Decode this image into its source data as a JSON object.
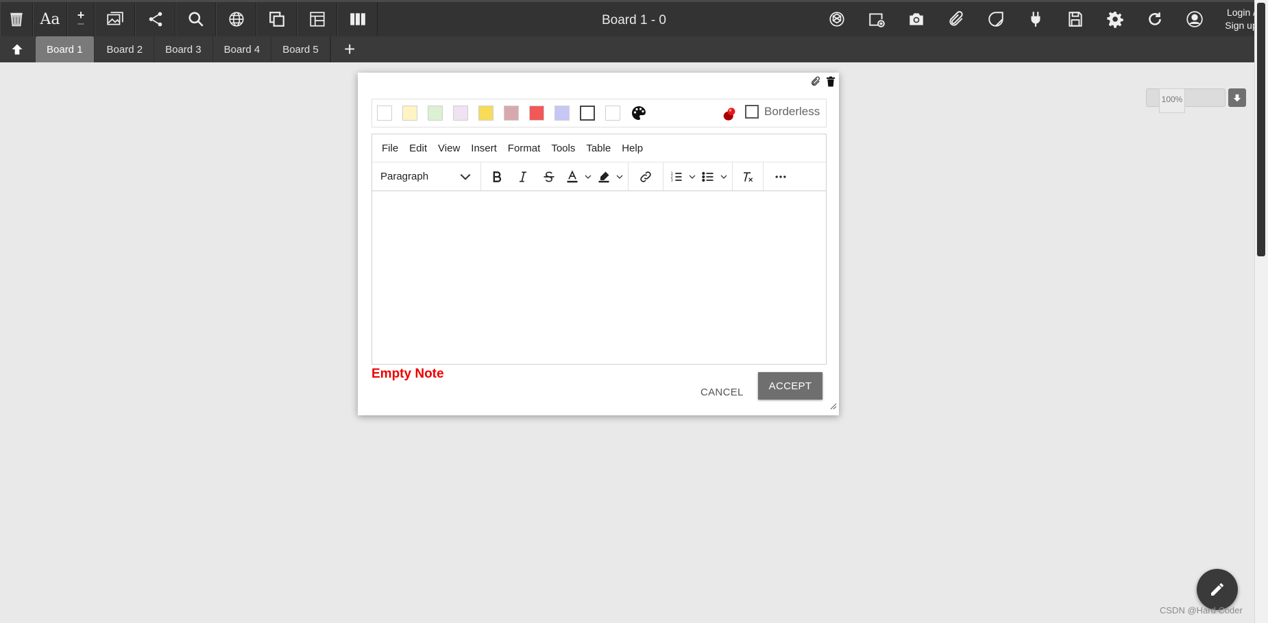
{
  "app": {
    "board_title": "Board 1 - 0",
    "login_line1": "Login /",
    "login_line2": "Sign up"
  },
  "toolbar": {
    "left_icons": [
      "trash-bin-icon",
      "font-icon",
      "add-icon",
      "image-icon",
      "share-icon",
      "search-icon",
      "globe-icon",
      "stack-icon",
      "layout-icon",
      "columns-icon"
    ],
    "font_label": "Aa",
    "right_icons": [
      "openai-icon",
      "add-note-icon",
      "camera-icon",
      "paperclip-icon",
      "sticker-icon",
      "plug-icon",
      "save-icon",
      "gear-icon",
      "refresh-icon",
      "user-icon"
    ]
  },
  "tabs": {
    "items": [
      "Board 1",
      "Board 2",
      "Board 3",
      "Board 4",
      "Board 5"
    ],
    "active": "Board 1",
    "add_label": "+"
  },
  "zoom": {
    "value": "100%"
  },
  "note": {
    "colors": [
      "#ffffff",
      "#fff4c2",
      "#dcf0d4",
      "#efe2f2",
      "#f7dc5a",
      "#d7a9ad",
      "#f25858",
      "#c7c7f5",
      "#ffffff",
      "#ffffff"
    ],
    "borderless_label": "Borderless",
    "borderless_checked": false,
    "menus": [
      "File",
      "Edit",
      "View",
      "Insert",
      "Format",
      "Tools",
      "Table",
      "Help"
    ],
    "block_format": "Paragraph",
    "status": "Empty Note",
    "cancel_label": "CANCEL",
    "accept_label": "ACCEPT"
  },
  "watermark": "CSDN @Hard Coder"
}
